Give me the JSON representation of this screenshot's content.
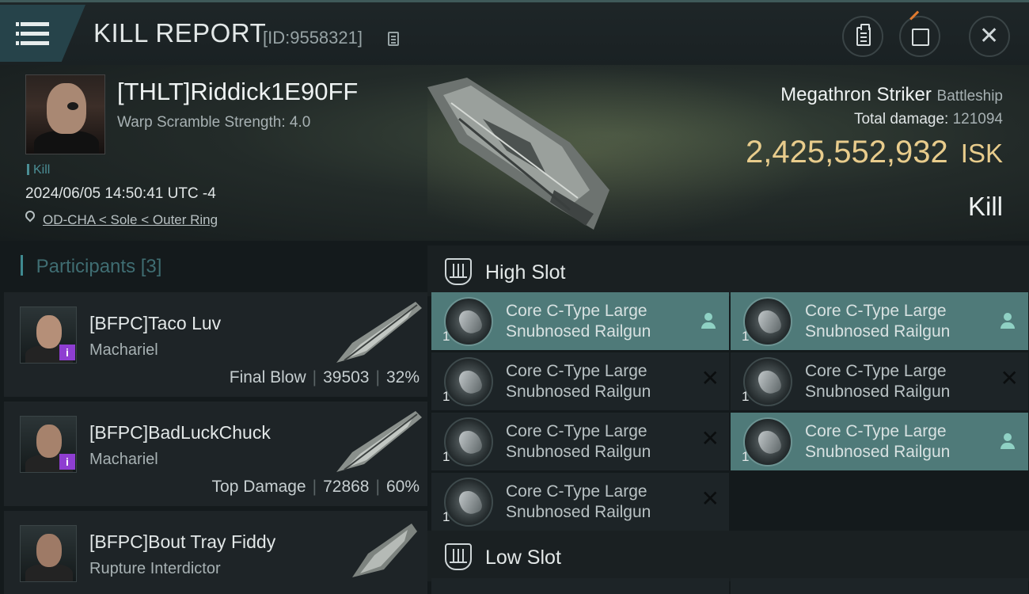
{
  "header": {
    "title": "KILL REPORT",
    "report_id": "[ID:9558321]"
  },
  "victim": {
    "name": "[THLT]Riddick1E90FF",
    "warp_scramble": "Warp Scramble Strength: 4.0",
    "tag": "Kill",
    "timestamp": "2024/06/05 14:50:41 UTC -4",
    "location": "OD-CHA < Sole < Outer Ring",
    "ship_name": "Megathron Striker",
    "ship_class": "Battleship",
    "total_damage_label": "Total damage:",
    "total_damage": "121094",
    "isk_value": "2,425,552,932",
    "isk_unit": "ISK",
    "result": "Kill"
  },
  "participants": {
    "label": "Participants",
    "count": "[3]",
    "rows": [
      {
        "name": "[BFPC]Taco Luv",
        "ship": "Machariel",
        "role": "Final Blow",
        "damage": "39503",
        "percent": "32%",
        "has_badge": true
      },
      {
        "name": "[BFPC]BadLuckChuck",
        "ship": "Machariel",
        "role": "Top Damage",
        "damage": "72868",
        "percent": "60%",
        "has_badge": true
      },
      {
        "name": "[BFPC]Bout Tray Fiddy",
        "ship": "Rupture Interdictor",
        "role": "",
        "damage": "",
        "percent": "",
        "has_badge": false
      }
    ]
  },
  "fitting": {
    "high_slot_label": "High Slot",
    "low_slot_label": "Low Slot",
    "high_slots": [
      {
        "name": "Core C-Type Large Snubnosed Railgun",
        "qty": "1",
        "status": "dropped"
      },
      {
        "name": "Core C-Type Large Snubnosed Railgun",
        "qty": "1",
        "status": "dropped"
      },
      {
        "name": "Core C-Type Large Snubnosed Railgun",
        "qty": "1",
        "status": "destroyed"
      },
      {
        "name": "Core C-Type Large Snubnosed Railgun",
        "qty": "1",
        "status": "destroyed"
      },
      {
        "name": "Core C-Type Large Snubnosed Railgun",
        "qty": "1",
        "status": "destroyed"
      },
      {
        "name": "Core C-Type Large Snubnosed Railgun",
        "qty": "1",
        "status": "dropped"
      },
      {
        "name": "Core C-Type Large Snubnosed Railgun",
        "qty": "1",
        "status": "destroyed"
      }
    ]
  },
  "icons": {
    "menu": "hamburger-menu-icon",
    "copy": "copy-icon",
    "clipboard": "clipboard-icon",
    "share": "share-icon",
    "close": "close-icon",
    "location": "location-pin-icon",
    "dropped": "person-icon",
    "destroyed": "x-icon"
  },
  "colors": {
    "accent": "#4b8e95",
    "isk": "#e8cc8c",
    "dropped_bg": "#4f7a79",
    "badge": "#8e3ed1"
  }
}
